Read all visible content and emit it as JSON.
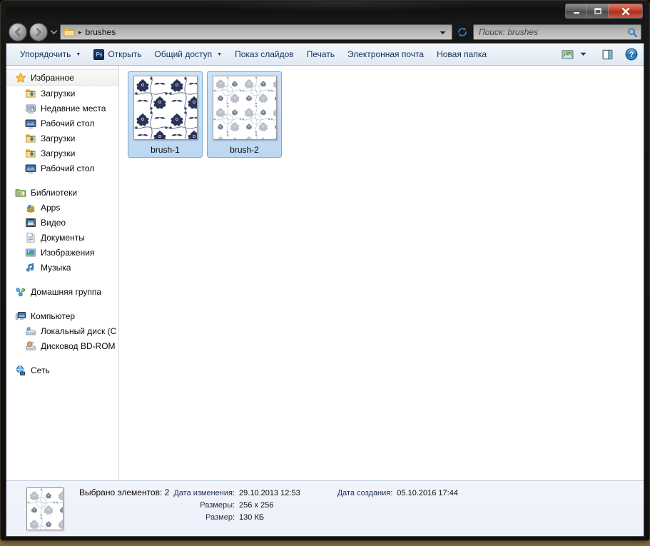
{
  "window": {
    "title": "brushes",
    "buttons": {
      "minimize": "minimize-button",
      "maximize": "maximize-button",
      "close": "close-button"
    }
  },
  "address": {
    "back_label": "Назад",
    "forward_label": "Вперед",
    "history_label": "Последние страницы",
    "folder_icon": "folder-icon",
    "separator": "▸",
    "crumb": "brushes",
    "dropdown_label": "Предыдущие расположения",
    "refresh_label": "Обновить"
  },
  "search": {
    "placeholder": "Поиск: brushes",
    "value": "",
    "icon": "search-icon"
  },
  "toolbar": {
    "organize": "Упорядочить",
    "open": "Открыть",
    "open_icon": "photoshop-icon",
    "share": "Общий доступ",
    "slideshow": "Показ слайдов",
    "print": "Печать",
    "email": "Электронная почта",
    "new_folder": "Новая папка",
    "view_icon": "view-mode-icon",
    "view_caret": "▾",
    "preview_icon": "preview-pane-icon",
    "help_icon": "help-icon",
    "caret": "▼"
  },
  "sidebar": {
    "groups": [
      {
        "header": {
          "label": "Избранное",
          "icon": "star-icon",
          "selected": true
        },
        "items": [
          {
            "label": "Загрузки",
            "icon": "downloads-icon"
          },
          {
            "label": "Недавние места",
            "icon": "recent-places-icon"
          },
          {
            "label": "Рабочий стол",
            "icon": "desktop-icon"
          },
          {
            "label": "Загрузки",
            "icon": "downloads-icon"
          },
          {
            "label": "Загрузки",
            "icon": "downloads-icon"
          },
          {
            "label": "Рабочий стол",
            "icon": "desktop-icon"
          }
        ]
      },
      {
        "header": {
          "label": "Библиотеки",
          "icon": "libraries-icon",
          "selected": false
        },
        "items": [
          {
            "label": "Apps",
            "icon": "apps-icon"
          },
          {
            "label": "Видео",
            "icon": "video-icon"
          },
          {
            "label": "Документы",
            "icon": "documents-icon"
          },
          {
            "label": "Изображения",
            "icon": "pictures-icon"
          },
          {
            "label": "Музыка",
            "icon": "music-icon"
          }
        ]
      },
      {
        "header": {
          "label": "Домашняя группа",
          "icon": "homegroup-icon",
          "selected": false
        },
        "items": []
      },
      {
        "header": {
          "label": "Компьютер",
          "icon": "computer-icon",
          "selected": false
        },
        "items": [
          {
            "label": "Локальный диск (C",
            "icon": "local-disk-icon"
          },
          {
            "label": "Дисковод BD-ROM",
            "icon": "bd-rom-icon"
          }
        ]
      },
      {
        "header": {
          "label": "Сеть",
          "icon": "network-icon",
          "selected": false
        },
        "items": []
      }
    ]
  },
  "files": [
    {
      "name": "brush-1",
      "selected": true,
      "pattern": "dark-floral"
    },
    {
      "name": "brush-2",
      "selected": true,
      "pattern": "light-floral"
    }
  ],
  "status": {
    "thumbnail": "light-floral",
    "selected_count_label": "Выбрано элементов: 2",
    "modified_key": "Дата изменения:",
    "modified_value": "29.10.2013 12:53",
    "created_key": "Дата создания:",
    "created_value": "05.10.2016 17:44",
    "dimensions_key": "Размеры:",
    "dimensions_value": "256 x 256",
    "size_key": "Размер:",
    "size_value": "130 КБ"
  },
  "colors": {
    "accent": "#14325c",
    "selection": "#bcd7f2",
    "selection_border": "#7aa8d4",
    "toolbar_bg": "#e9f0f7",
    "status_bg": "#eef1fa",
    "close_button": "#c03a26"
  }
}
